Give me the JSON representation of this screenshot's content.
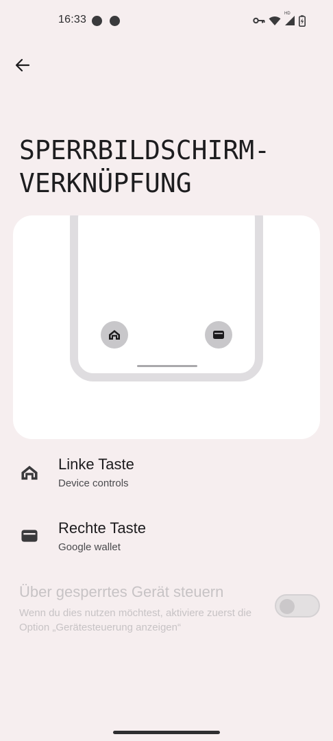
{
  "status_bar": {
    "time": "16:33",
    "notification_icons": [
      "signal-chat-icon",
      "signal-chat-icon"
    ],
    "right_icons": [
      "vpn-key-icon",
      "wifi-icon",
      "cellular-hd-icon",
      "battery-charging-icon"
    ],
    "hd_label": "HD"
  },
  "header": {
    "back_icon": "arrow-back-icon",
    "title": "SPERRBILDSCHIRM-\nVERKNÜPFUNG"
  },
  "preview": {
    "left_shortcut_icon": "home-icon",
    "right_shortcut_icon": "wallet-icon"
  },
  "items": [
    {
      "title": "Linke Taste",
      "subtitle": "Device controls",
      "icon": "home-icon"
    },
    {
      "title": "Rechte Taste",
      "subtitle": "Google wallet",
      "icon": "wallet-icon"
    }
  ],
  "locked_device": {
    "title": "Über gesperrtes Gerät steuern",
    "subtitle": "Wenn du dies nutzen möchtest, aktiviere zuerst die Option „Gerätesteuerung anzeigen“",
    "toggle_on": false,
    "enabled": false
  },
  "colors": {
    "background": "#f6eeef",
    "card": "#ffffff",
    "disabled_text": "#c7c3c5"
  }
}
